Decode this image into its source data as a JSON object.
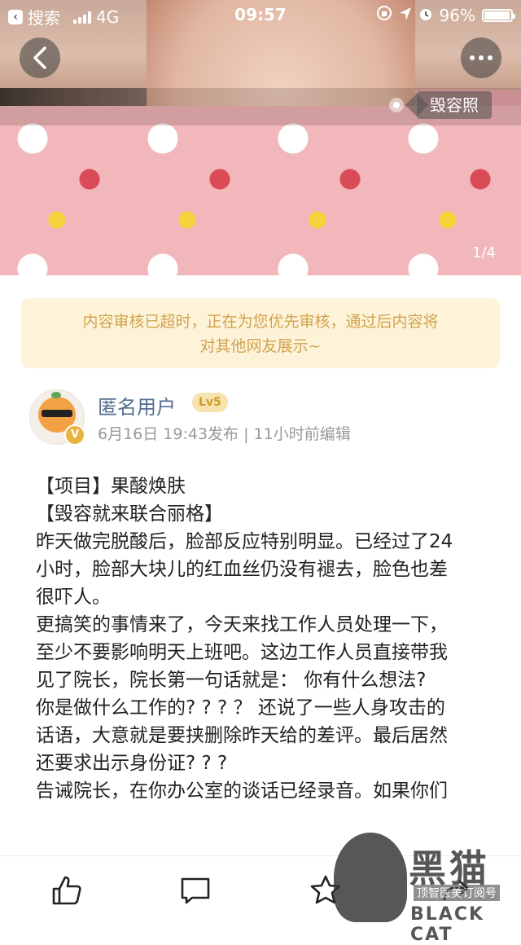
{
  "status_bar": {
    "back_app": "搜索",
    "network": "4G",
    "time": "09:57",
    "battery": "96%",
    "battery_level": 0.96
  },
  "hero": {
    "tag_label": "毁容照",
    "pager": "1/4"
  },
  "notice": {
    "line1": "内容审核已超时，正在为您优先审核，通过后内容将",
    "line2": "对其他网友展示~"
  },
  "user": {
    "name": "匿名用户",
    "level": "Lv5",
    "avatar_badge": "V",
    "meta": "6月16日  19:43发布  |  11小时前编辑"
  },
  "post": {
    "lines": [
      "【项目】果酸焕肤",
      "【毁容就来联合丽格】",
      "昨天做完脱酸后，脸部反应特别明显。已经过了24",
      "小时，脸部大块儿的红血丝仍没有褪去，脸色也差",
      "很吓人。",
      "更搞笑的事情来了，今天来找工作人员处理一下，",
      "至少不要影响明天上班吧。这边工作人员直接带我",
      "见了院长，院长第一句话就是： 你有什么想法?",
      "你是做什么工作的? ? ? ？ 还说了一些人身攻击的",
      "话语，大意就是要挟删除昨天给的差评。最后居然",
      "还要求出示身份证? ? ?",
      "告诫院长，在你办公室的谈话已经录音。如果你们"
    ]
  },
  "watermark": {
    "logo_text": "黑猫",
    "sub": "顶智医美订阅号",
    "bottom": "BLACK CAT"
  },
  "colors": {
    "notice_bg": "#fcf3d8",
    "notice_text": "#d4a24e",
    "username": "#546d8f",
    "level_bg": "#f6e3ad"
  }
}
